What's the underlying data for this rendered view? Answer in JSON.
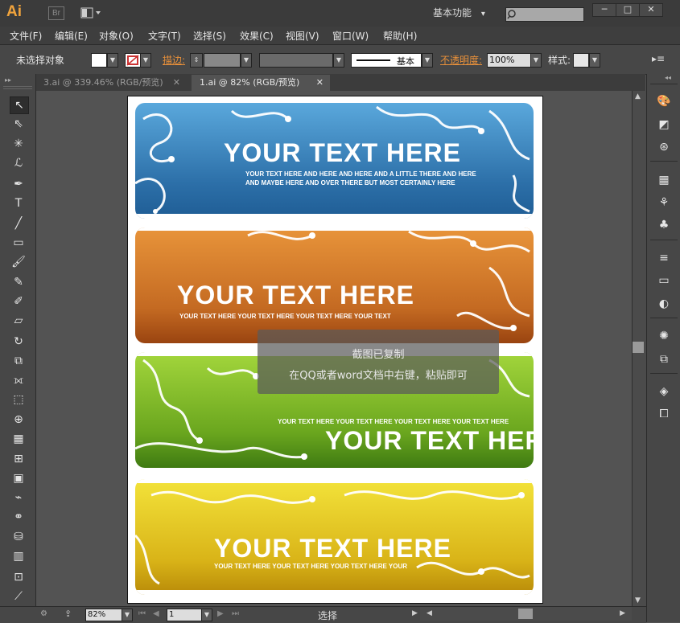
{
  "titlebar": {
    "app_logo": "Ai",
    "bridge_logo": "Br",
    "workspace": "基本功能",
    "workspace_arrow": "▾",
    "minimize": "─",
    "maximize": "□",
    "close": "✕"
  },
  "menu": [
    "文件(F)",
    "编辑(E)",
    "对象(O)",
    "文字(T)",
    "选择(S)",
    "效果(C)",
    "视图(V)",
    "窗口(W)",
    "帮助(H)"
  ],
  "control": {
    "selection_status": "未选择对象",
    "stroke_label": "描边:",
    "stroke_style": "基本",
    "opacity_label": "不透明度:",
    "opacity_value": "100%",
    "style_label": "样式:"
  },
  "tabs": [
    {
      "label": "3.ai @ 339.46% (RGB/预览)",
      "active": false,
      "close": "✕"
    },
    {
      "label": "1.ai @ 82% (RGB/预览)",
      "active": true,
      "close": "✕"
    }
  ],
  "tools": {
    "left": [
      "selection-tool-icon",
      "direct-selection-tool-icon",
      "magic-wand-tool-icon",
      "lasso-tool-icon",
      "pen-tool-icon",
      "type-tool-icon",
      "line-tool-icon",
      "rectangle-tool-icon",
      "paintbrush-tool-icon",
      "pencil-tool-icon",
      "blob-brush-tool-icon",
      "eraser-tool-icon",
      "rotate-tool-icon",
      "scale-tool-icon",
      "width-tool-icon",
      "free-transform-tool-icon",
      "shape-builder-tool-icon",
      "perspective-grid-tool-icon",
      "mesh-tool-icon",
      "gradient-tool-icon",
      "eyedropper-tool-icon",
      "blend-tool-icon",
      "symbol-sprayer-tool-icon",
      "column-graph-tool-icon",
      "artboard-tool-icon",
      "slice-tool-icon",
      "hand-tool-icon"
    ],
    "right": [
      "color-panel-icon",
      "color-guide-icon",
      "kuler-icon",
      "swatches-icon",
      "brushes-icon",
      "symbols-icon",
      "stroke-panel-icon",
      "gradient-panel-icon",
      "transparency-panel-icon",
      "appearance-panel-icon",
      "graphic-styles-icon",
      "layers-panel-icon",
      "artboards-panel-icon"
    ]
  },
  "artboard": {
    "banners": [
      {
        "title": "YOUR TEXT HERE",
        "sub1": "YOUR TEXT HERE AND HERE AND HERE AND A LITTLE THERE AND HERE",
        "sub2": "AND MAYBE HERE AND OVER THERE BUT MOST CERTAINLY HERE",
        "color_top": "#5aa8dc",
        "color_bottom": "#1f5d95"
      },
      {
        "title": "YOUR TEXT HERE",
        "sub1": "YOUR TEXT HERE YOUR TEXT HERE YOUR TEXT HERE YOUR TEXT",
        "color_top": "#e8943a",
        "color_bottom": "#9a4410"
      },
      {
        "title": "YOUR TEXT HERE",
        "sub1": "YOUR TEXT HERE YOUR TEXT HERE YOUR TEXT HERE YOUR TEXT HERE",
        "color_top": "#a3d63c",
        "color_bottom": "#3f7a12"
      },
      {
        "title": "YOUR TEXT HERE",
        "sub1": "YOUR TEXT HERE YOUR TEXT HERE YOUR TEXT HERE YOUR",
        "color_top": "#f3e33a",
        "color_bottom": "#b88a08"
      }
    ]
  },
  "toast": {
    "title": "截图已复制",
    "message": "在QQ或者word文档中右键，粘贴即可"
  },
  "status": {
    "zoom": "82%",
    "artboard_index": "1",
    "tool_name": "选择"
  }
}
